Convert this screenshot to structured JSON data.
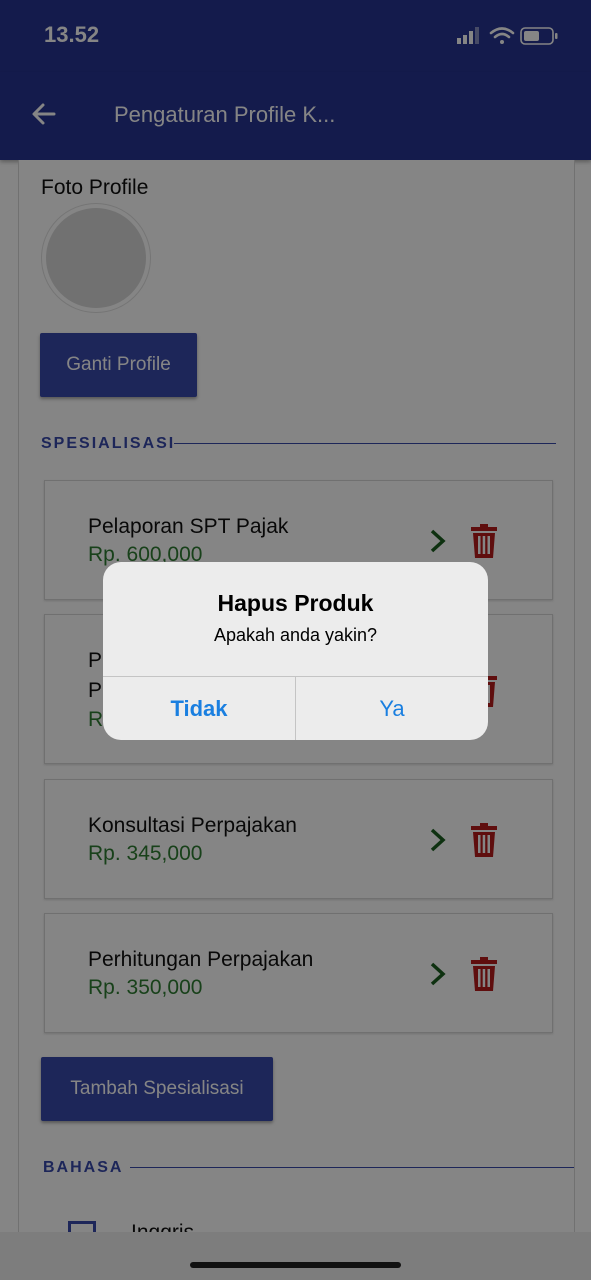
{
  "status_bar": {
    "time": "13.52"
  },
  "app_bar": {
    "title": "Pengaturan Profile K..."
  },
  "profile": {
    "photo_label": "Foto Profile",
    "change_button": "Ganti Profile"
  },
  "specializations": {
    "heading": "SPESIALISASI",
    "items": [
      {
        "name": "Pelaporan SPT Pajak",
        "price": "Rp. 600,000"
      },
      {
        "name": "P",
        "name2": "P",
        "price": "R"
      },
      {
        "name": "Konsultasi Perpajakan",
        "price": "Rp. 345,000"
      },
      {
        "name": "Perhitungan Perpajakan",
        "price": "Rp. 350,000"
      }
    ],
    "add_button": "Tambah Spesialisasi"
  },
  "languages": {
    "heading": "BAHASA",
    "items": [
      {
        "label": "Inggris",
        "checked": true
      }
    ]
  },
  "dialog": {
    "title": "Hapus Produk",
    "message": "Apakah anda yakin?",
    "cancel": "Tidak",
    "confirm": "Ya"
  },
  "colors": {
    "primary": "#283593",
    "accent": "#3949ab",
    "price": "#2e7d32",
    "delete": "#b71c1c",
    "chevron": "#1b5e20",
    "ios_link": "#1a7fe0"
  },
  "icons": [
    "back-arrow-icon",
    "signal-icon",
    "wifi-icon",
    "battery-icon",
    "chevron-right-icon",
    "trash-icon",
    "checkbox-icon"
  ]
}
